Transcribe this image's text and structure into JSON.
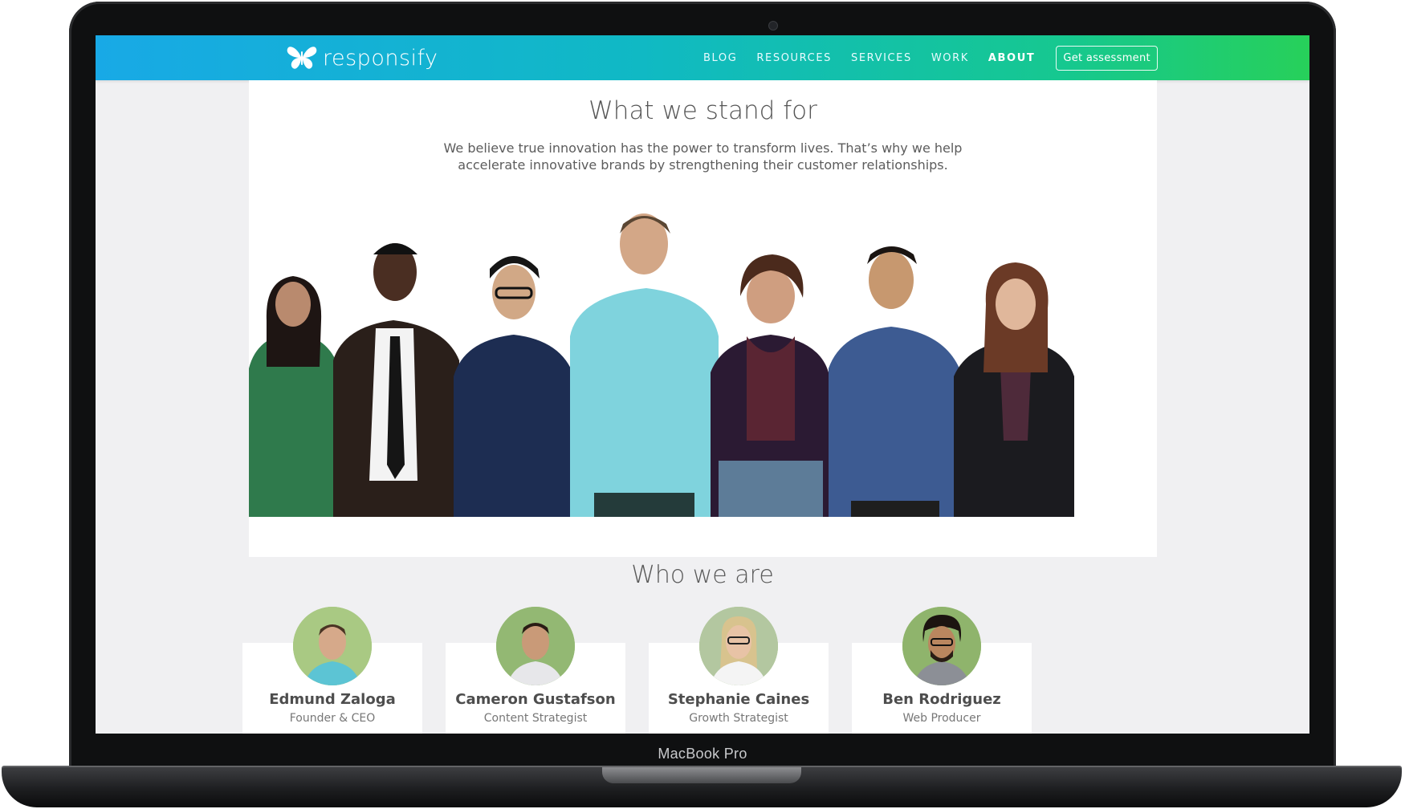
{
  "device": {
    "model_label": "MacBook Pro"
  },
  "brand": {
    "name": "responsify",
    "logo_icon": "butterfly-icon"
  },
  "nav": {
    "items": [
      {
        "label": "BLOG",
        "active": false
      },
      {
        "label": "RESOURCES",
        "active": false
      },
      {
        "label": "SERVICES",
        "active": false
      },
      {
        "label": "WORK",
        "active": false
      },
      {
        "label": "ABOUT",
        "active": true
      }
    ],
    "cta_label": "Get assessment"
  },
  "hero": {
    "title": "What we stand for",
    "body": "We believe true innovation has the power to transform lives. That’s why we help accelerate innovative brands by strengthening their customer relationships."
  },
  "team_section": {
    "title": "Who we are",
    "members": [
      {
        "name": "Edmund Zaloga",
        "role": "Founder & CEO"
      },
      {
        "name": "Cameron Gustafson",
        "role": "Content Strategist"
      },
      {
        "name": "Stephanie Caines",
        "role": "Growth Strategist"
      },
      {
        "name": "Ben Rodriguez",
        "role": "Web Producer"
      }
    ]
  },
  "colors": {
    "nav_gradient_start": "#18a9e6",
    "nav_gradient_end": "#27d05a",
    "page_background": "#f0f0f2"
  }
}
